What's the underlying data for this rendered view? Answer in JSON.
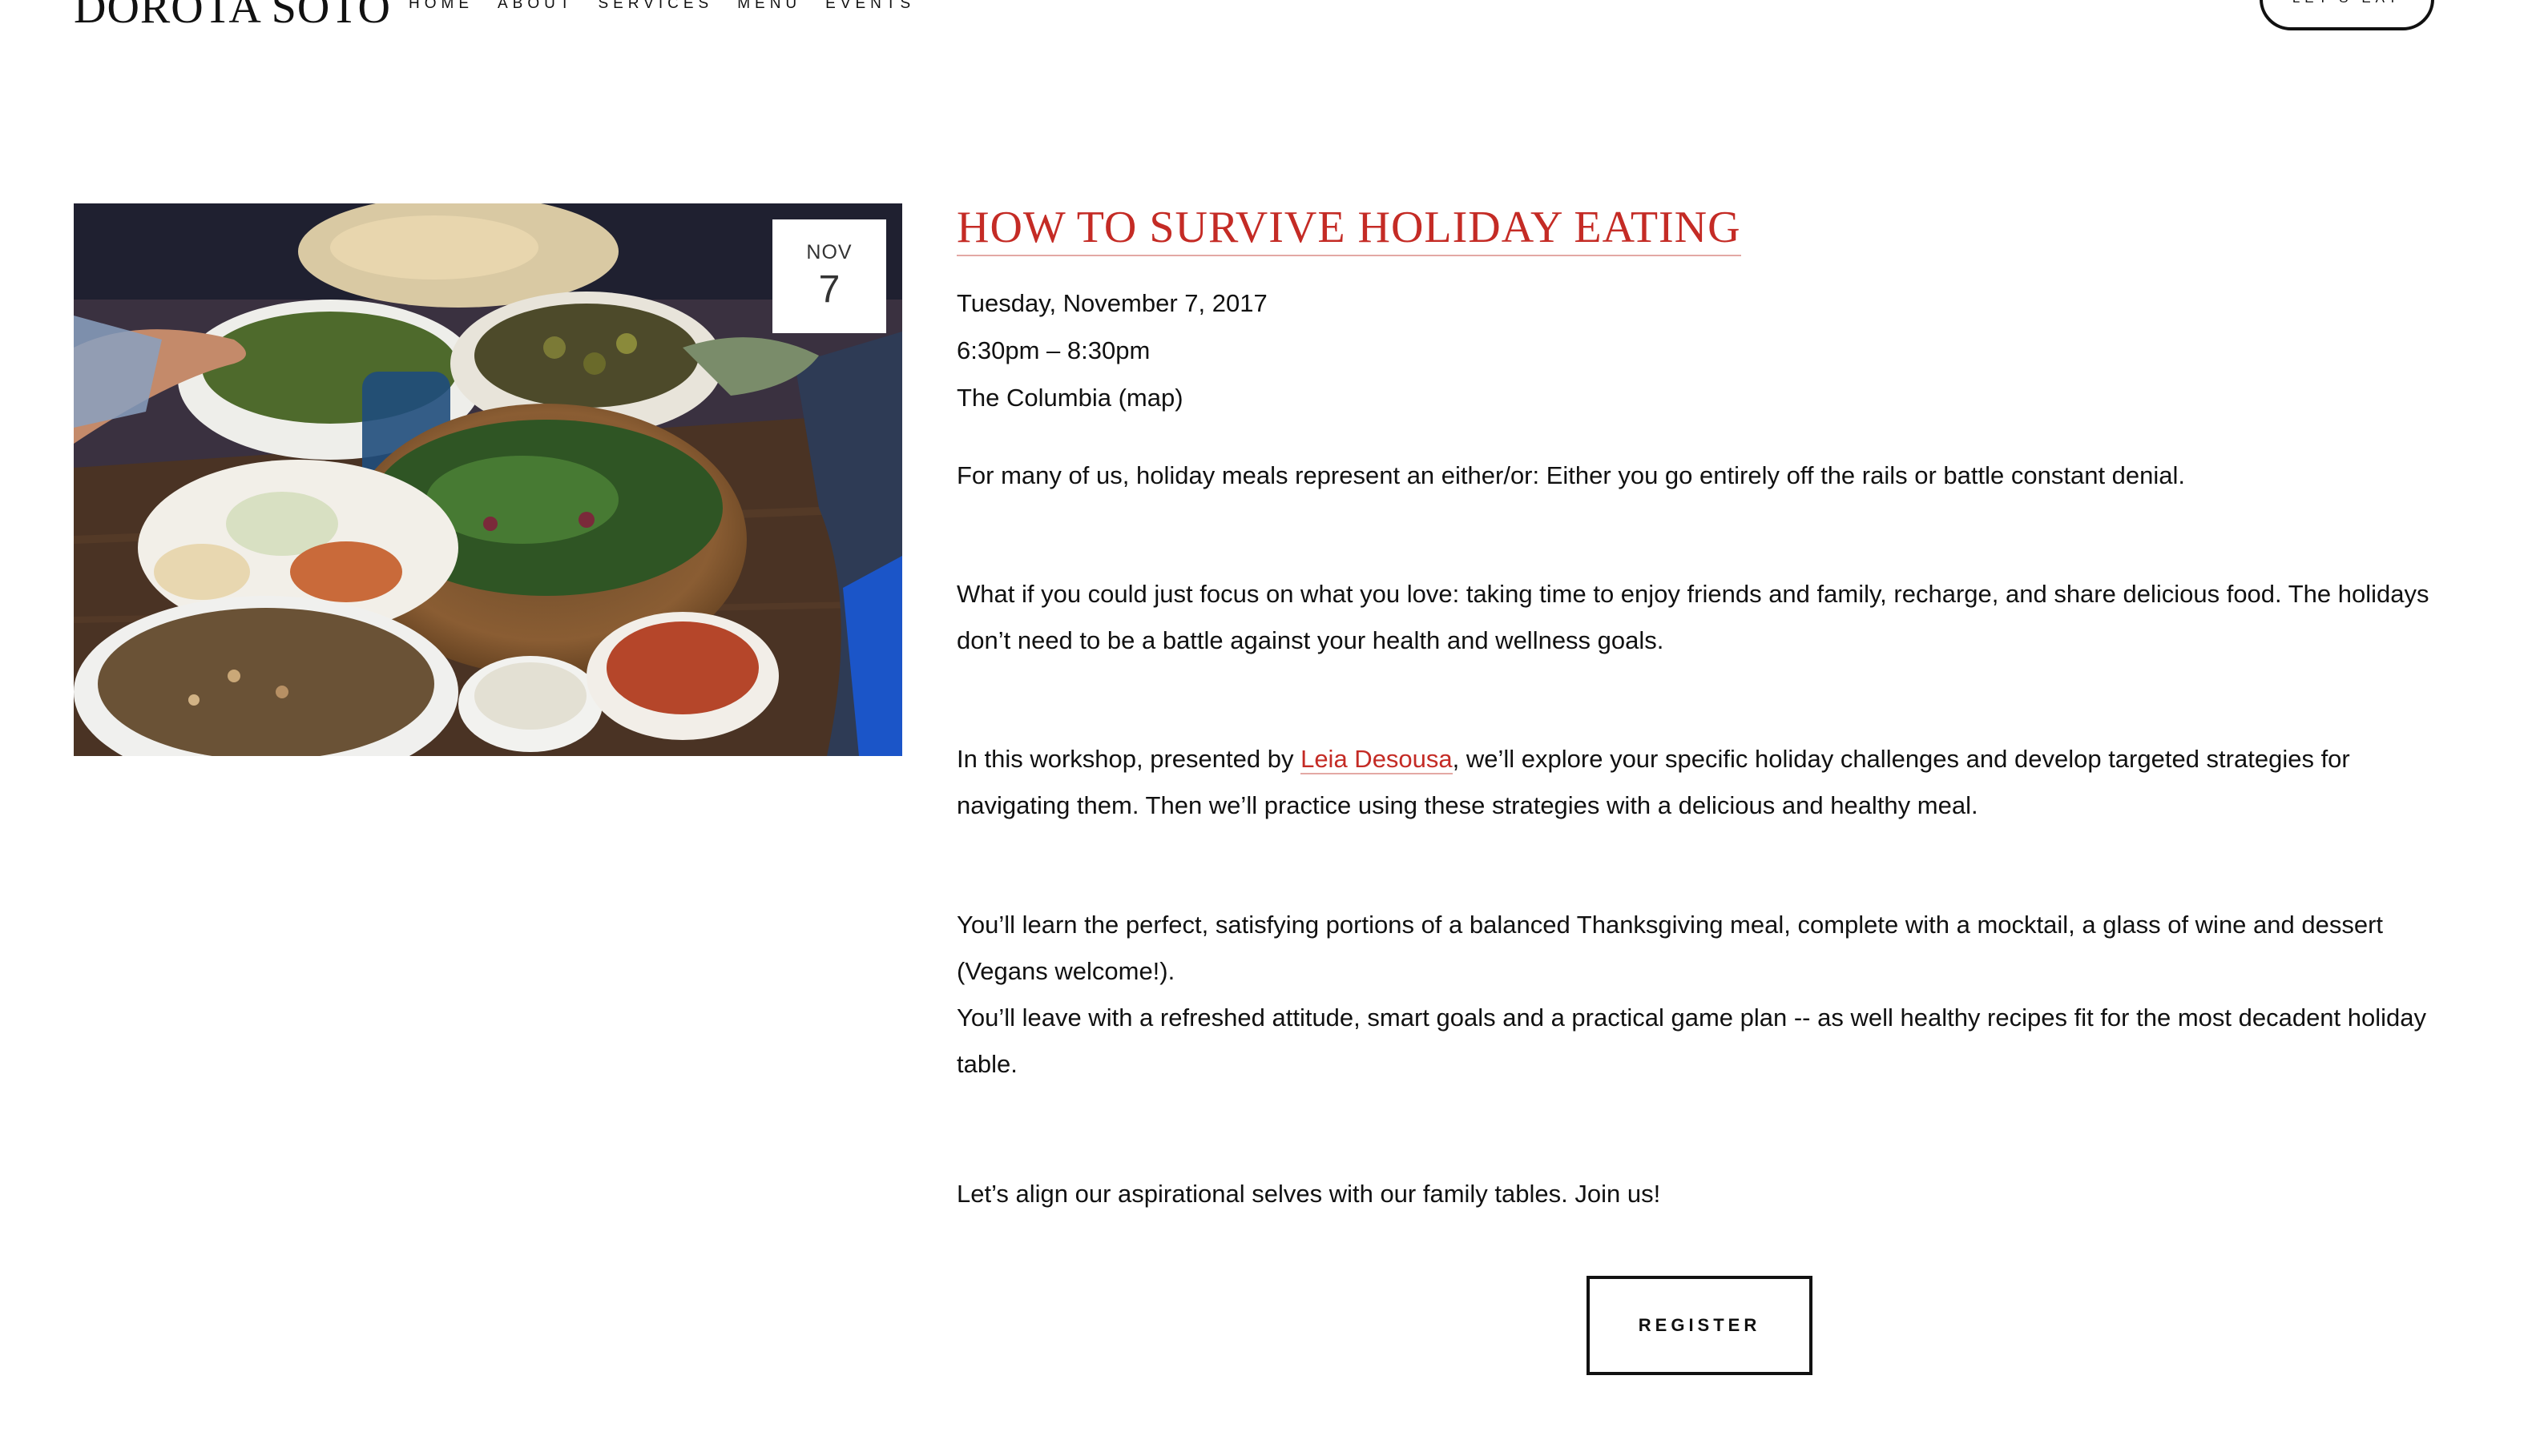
{
  "header": {
    "site_title": "DOROTA SOTO",
    "nav": [
      {
        "label": "HOME"
      },
      {
        "label": "ABOUT"
      },
      {
        "label": "SERVICES"
      },
      {
        "label": "MENU"
      },
      {
        "label": "EVENTS"
      }
    ],
    "cta_label": "LET'S EAT"
  },
  "event": {
    "badge_month": "NOV",
    "badge_day": "7",
    "title": "HOW TO SURVIVE HOLIDAY EATING",
    "date": "Tuesday, November 7, 2017",
    "time": "6:30pm – 8:30pm",
    "location": "The Columbia",
    "map_link": "(map)",
    "description": {
      "p1": "For many of us, holiday meals represent an either/or:  Either you go entirely off the rails or battle constant denial.",
      "p2": "What if you could just focus on what you love: taking time to enjoy friends and family, recharge, and share delicious food.  The holidays don’t need to be a battle against your health and wellness goals.",
      "p3_before": "In this workshop, presented by ",
      "p3_link": "Leia Desousa",
      "p3_after": ", we’ll explore your specific holiday challenges and develop targeted strategies for navigating them. Then we’ll practice using these strategies with a delicious and healthy meal.",
      "p4_line1": "You’ll learn the perfect, satisfying portions of a balanced Thanksgiving meal, complete with a mocktail, a glass of wine and dessert (Vegans welcome!).",
      "p4_line2": "You’ll leave with a refreshed attitude, smart goals and a practical game plan -- as well healthy recipes fit for the most decadent holiday table.",
      "p5": "Let’s align our aspirational selves with our family tables.  Join us!"
    },
    "register_label": "REGISTER"
  },
  "colors": {
    "accent": "#c42b25",
    "text": "#111111",
    "background": "#ffffff"
  }
}
